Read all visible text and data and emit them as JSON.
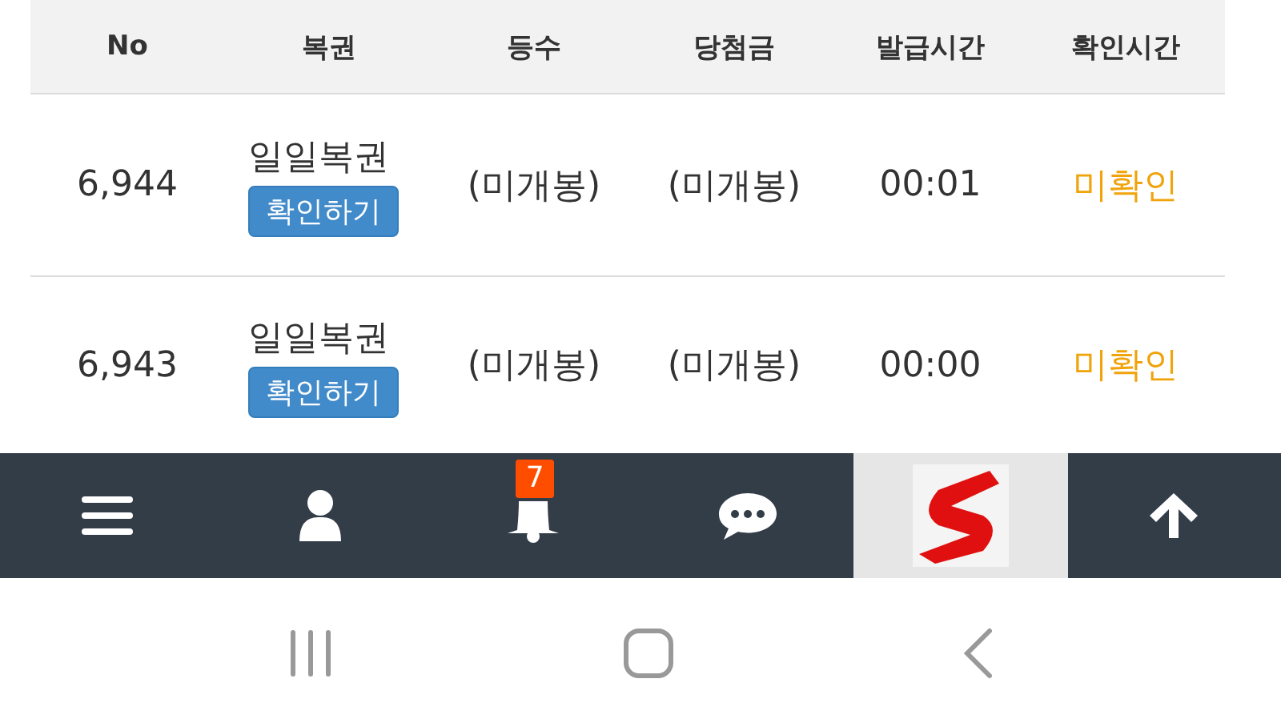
{
  "table": {
    "columns": [
      "No",
      "복권",
      "등수",
      "당첨금",
      "발급시간",
      "확인시간"
    ],
    "rows": [
      {
        "no": "6,944",
        "ticket": "일일복권",
        "button": "확인하기",
        "rank": "(미개봉)",
        "prize": "(미개봉)",
        "issued": "00:01",
        "checked_time": "미확인",
        "confirmed": false
      },
      {
        "no": "6,943",
        "ticket": "일일복권",
        "button": "확인하기",
        "rank": "(미개봉)",
        "prize": "(미개봉)",
        "issued": "00:00",
        "checked_time": "미확인",
        "confirmed": false
      }
    ]
  },
  "bottom_bar": [
    {
      "kind": "menu"
    },
    {
      "kind": "user"
    },
    {
      "kind": "bell",
      "badge": "7"
    },
    {
      "kind": "chat"
    },
    {
      "kind": "logo"
    },
    {
      "kind": "top"
    }
  ],
  "system_nav": [
    {
      "kind": "recents"
    },
    {
      "kind": "home"
    },
    {
      "kind": "back"
    }
  ]
}
